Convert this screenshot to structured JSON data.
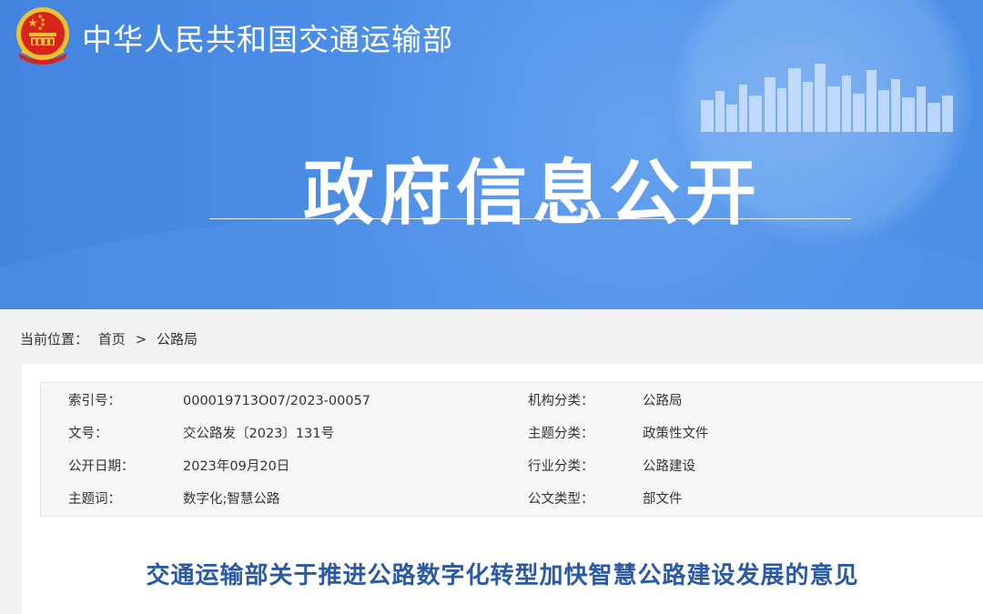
{
  "header": {
    "ministry_name": "中华人民共和国交通运输部",
    "section_title": "政府信息公开"
  },
  "breadcrumb": {
    "prefix": "当前位置：",
    "items": [
      "首页",
      "公路局"
    ],
    "separator": ">"
  },
  "metadata": {
    "rows": [
      {
        "label_left": "索引号：",
        "value_left": "000019713O07/2023-00057",
        "label_right": "机构分类：",
        "value_right": "公路局"
      },
      {
        "label_left": "文号：",
        "value_left": "交公路发〔2023〕131号",
        "label_right": "主题分类：",
        "value_right": "政策性文件"
      },
      {
        "label_left": "公开日期：",
        "value_left": "2023年09月20日",
        "label_right": "行业分类：",
        "value_right": "公路建设"
      },
      {
        "label_left": "主题词：",
        "value_left": "数字化;智慧公路",
        "label_right": "公文类型：",
        "value_right": "部文件"
      }
    ]
  },
  "document": {
    "title": "交通运输部关于推进公路数字化转型加快智慧公路建设发展的意见"
  },
  "colors": {
    "banner_blue": "#4a8fe6",
    "title_blue": "#2b5aa4",
    "emblem_red": "#d8241a",
    "emblem_gold": "#f3c02e"
  },
  "icons": {
    "emblem": "national-emblem-icon",
    "skyline": "city-skyline-graphic"
  }
}
